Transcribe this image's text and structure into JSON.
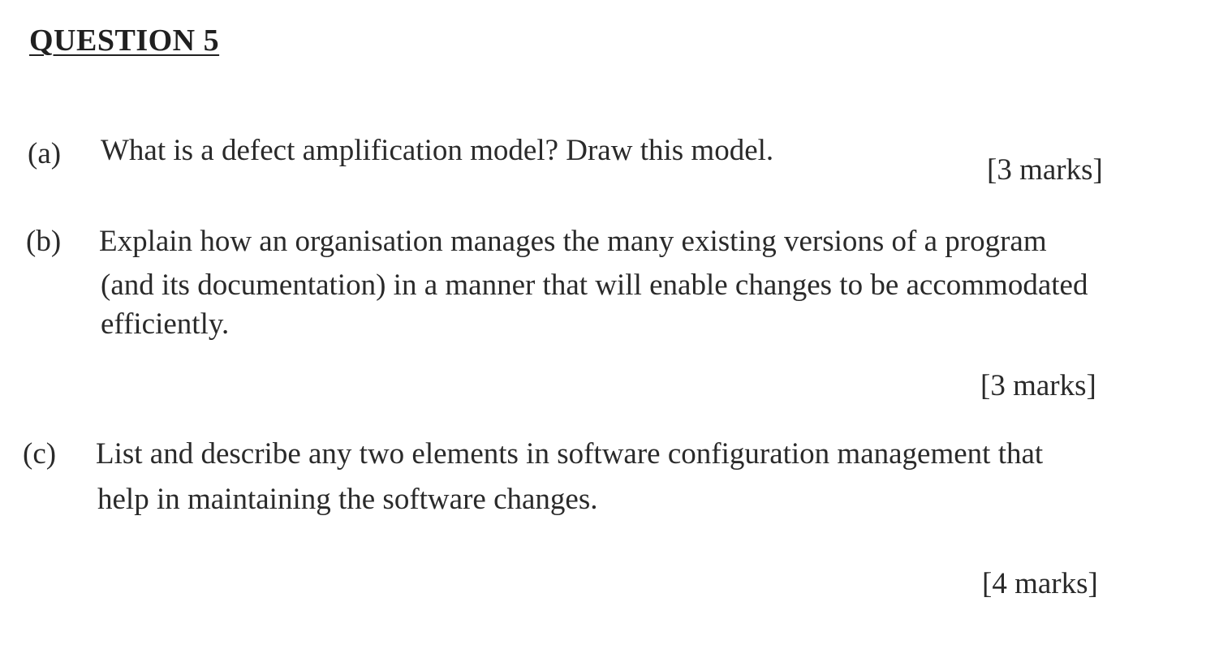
{
  "question": {
    "heading": "QUESTION 5"
  },
  "parts": [
    {
      "label": "(a)",
      "text": "What is a defect amplification model? Draw this model.",
      "marks": "[3 marks]"
    },
    {
      "label": "(b)",
      "lines": [
        "Explain how an organisation manages the many existing versions of a program",
        "(and its documentation) in a manner that will enable changes to be accommodated",
        "efficiently."
      ],
      "marks": "[3 marks]"
    },
    {
      "label": "(c)",
      "lines": [
        "List and describe any two elements in software configuration management that",
        "help in maintaining the software changes."
      ],
      "marks": "[4 marks]"
    }
  ]
}
